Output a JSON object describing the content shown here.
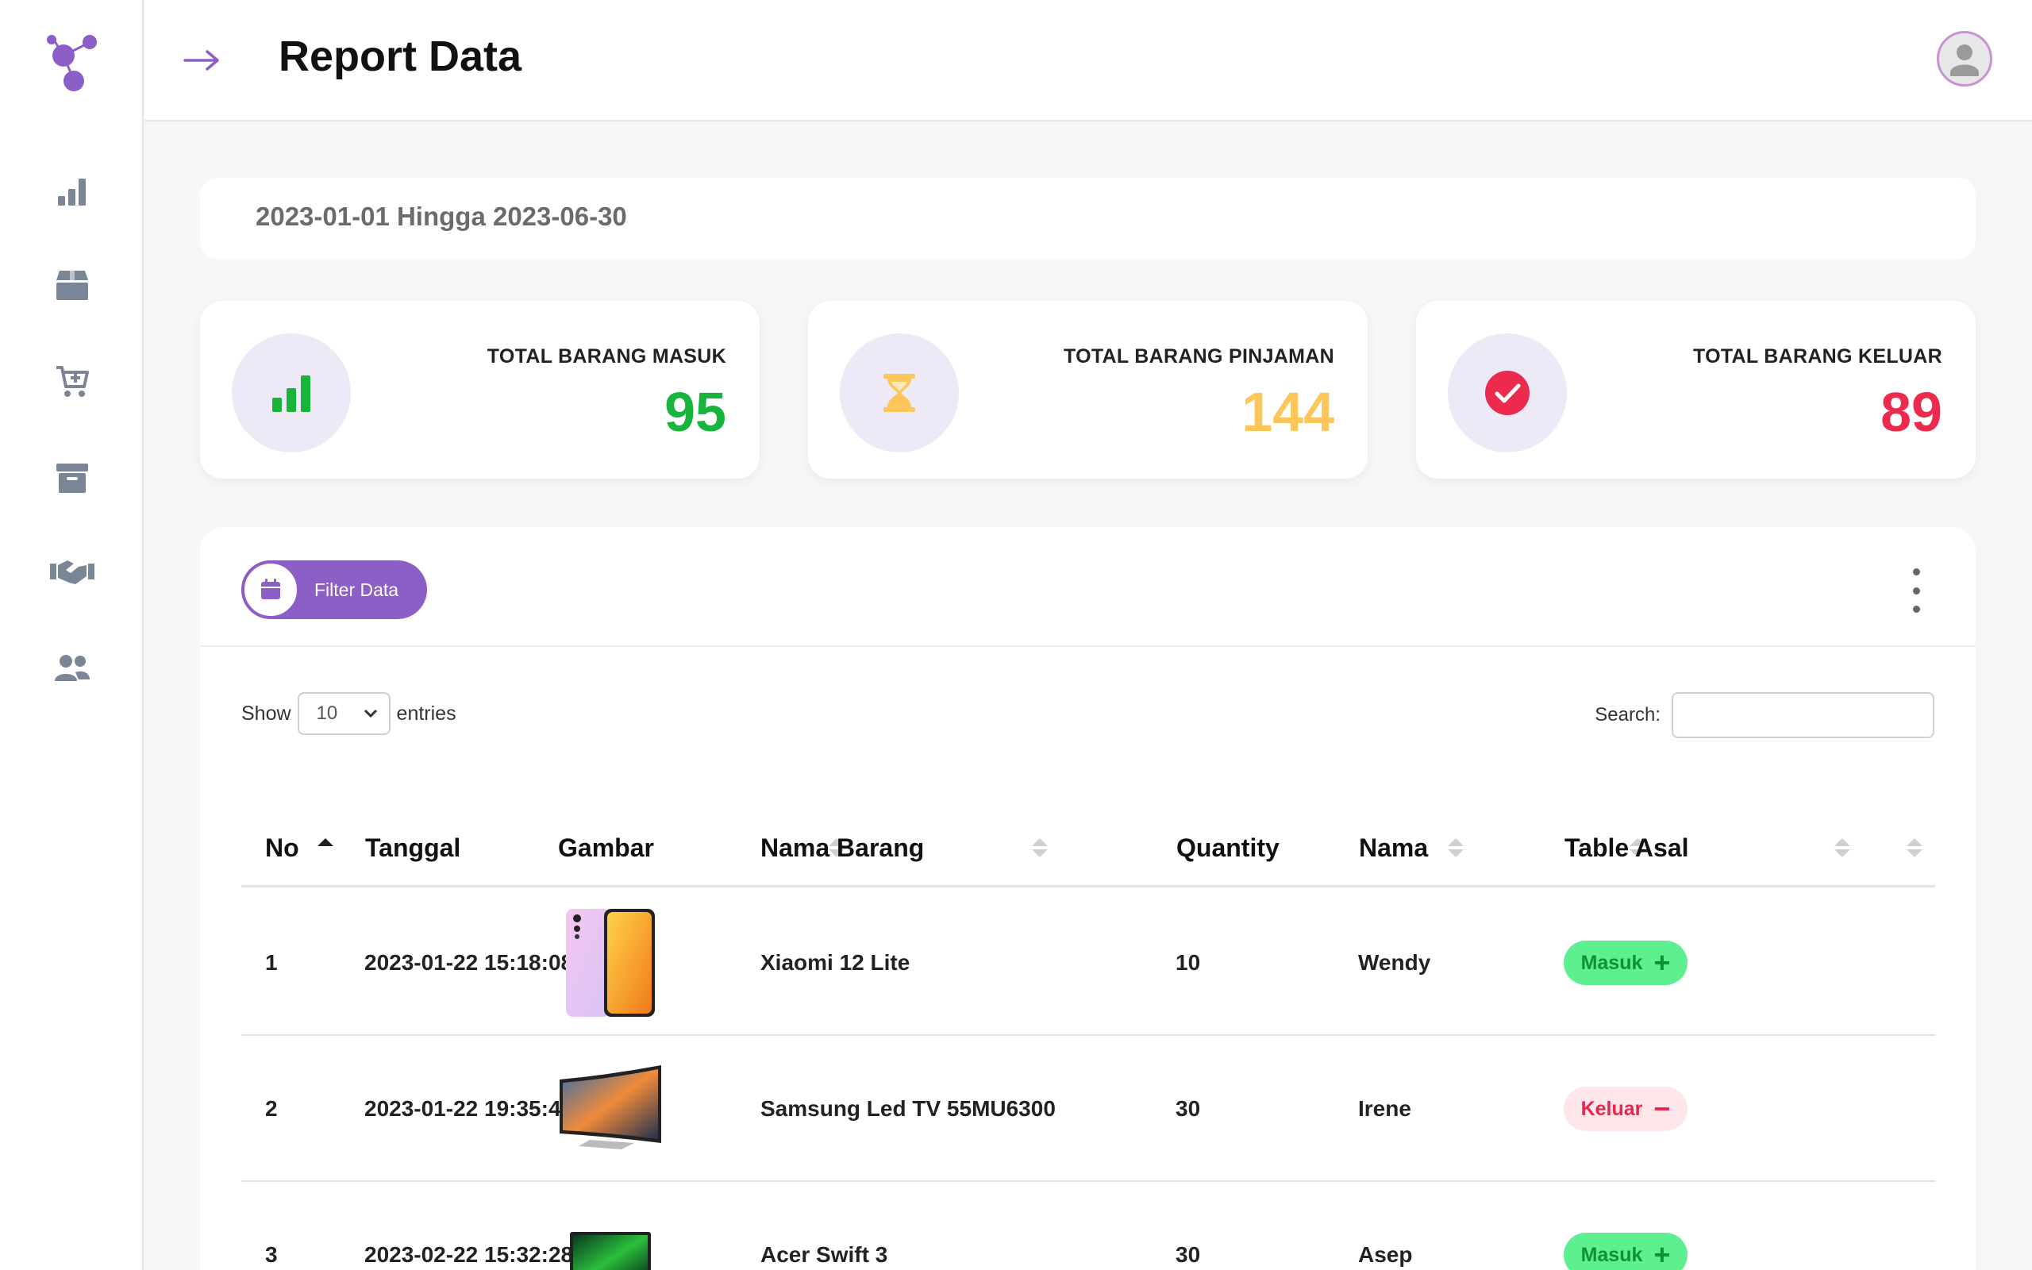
{
  "header": {
    "title": "Report Data"
  },
  "sidebar": {
    "items": [
      {
        "icon": "bar-chart-icon"
      },
      {
        "icon": "box-icon"
      },
      {
        "icon": "cart-plus-icon"
      },
      {
        "icon": "archive-icon"
      },
      {
        "icon": "handshake-icon"
      },
      {
        "icon": "users-icon"
      }
    ]
  },
  "date_range": "2023-01-01 Hingga 2023-06-30",
  "stats": [
    {
      "label": "TOTAL BARANG MASUK",
      "value": "95",
      "color": "#18b43c",
      "icon": "bar-chart-icon"
    },
    {
      "label": "TOTAL BARANG PINJAMAN",
      "value": "144",
      "color": "#fdc65b",
      "icon": "hourglass-icon"
    },
    {
      "label": "TOTAL BARANG KELUAR",
      "value": "89",
      "color": "#eb2a4d",
      "icon": "check-circle-icon"
    }
  ],
  "filter": {
    "label": "Filter Data"
  },
  "table_controls": {
    "show_label": "Show",
    "entries_value": "10",
    "entries_label": "entries",
    "search_label": "Search:"
  },
  "table": {
    "columns": [
      "No",
      "Tanggal",
      "Gambar",
      "Nama Barang",
      "Quantity",
      "Nama",
      "Table Asal"
    ],
    "rows": [
      {
        "no": "1",
        "tanggal": "2023-01-22 15:18:08",
        "gambar": "phone-image",
        "nama_barang": "Xiaomi 12 Lite",
        "quantity": "10",
        "nama": "Wendy",
        "table_asal": "Masuk",
        "sign": "+"
      },
      {
        "no": "2",
        "tanggal": "2023-01-22 19:35:46",
        "gambar": "tv-image",
        "nama_barang": "Samsung Led TV 55MU6300",
        "quantity": "30",
        "nama": "Irene",
        "table_asal": "Keluar",
        "sign": "−"
      },
      {
        "no": "3",
        "tanggal": "2023-02-22 15:32:28",
        "gambar": "laptop-image",
        "nama_barang": "Acer Swift 3",
        "quantity": "30",
        "nama": "Asep",
        "table_asal": "Masuk",
        "sign": "+"
      }
    ]
  },
  "colors": {
    "accent": "#8b5fc6",
    "sidebar_icon": "#7a8596"
  }
}
